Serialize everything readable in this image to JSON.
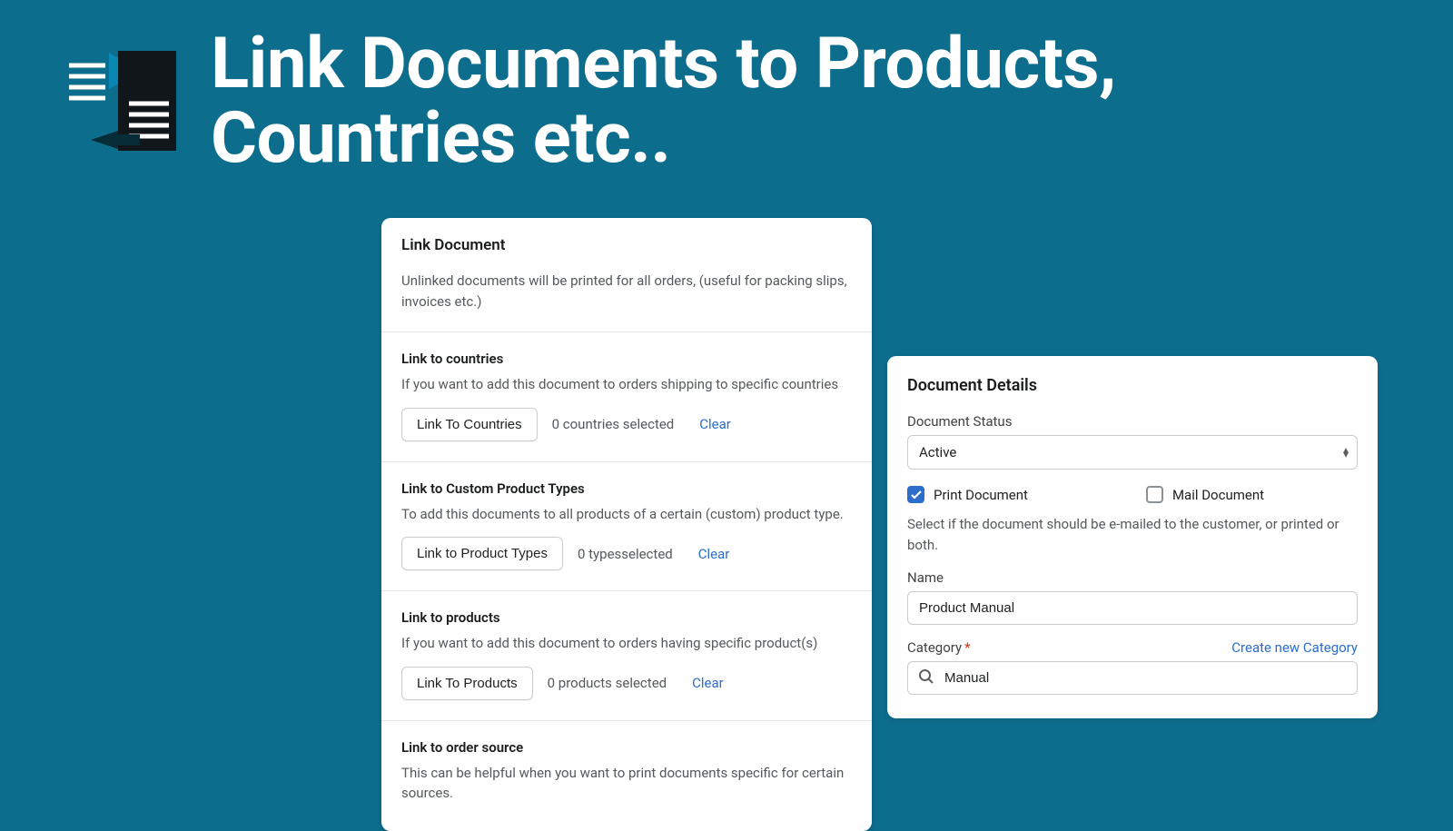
{
  "page": {
    "title": "Link Documents to Products, Countries etc.."
  },
  "linkCard": {
    "title": "Link Document",
    "subtitle": "Unlinked documents will be printed for all orders, (useful for packing slips, invoices etc.)",
    "sections": {
      "countries": {
        "heading": "Link to countries",
        "sub": "If you want to add this document to orders shipping to specific countries",
        "button": "Link To Countries",
        "count": "0 countries selected",
        "clear": "Clear"
      },
      "types": {
        "heading": "Link to Custom Product Types",
        "sub": "To add this documents to all products of a certain (custom) product type.",
        "button": "Link to Product Types",
        "count": "0 typesselected",
        "clear": "Clear"
      },
      "products": {
        "heading": "Link to products",
        "sub": "If you want to add this document to orders having specific product(s)",
        "button": "Link To Products",
        "count": "0 products selected",
        "clear": "Clear"
      },
      "source": {
        "heading": "Link to order source",
        "sub": "This can be helpful when you want to print documents specific for certain sources."
      }
    }
  },
  "details": {
    "title": "Document Details",
    "statusLabel": "Document Status",
    "statusValue": "Active",
    "printLabel": "Print Document",
    "printChecked": true,
    "mailLabel": "Mail Document",
    "mailChecked": false,
    "help": "Select if the document should be e-mailed to the customer, or printed or both.",
    "nameLabel": "Name",
    "nameValue": "Product Manual",
    "categoryLabel": "Category",
    "categoryValue": "Manual",
    "createCategory": "Create new Category"
  }
}
